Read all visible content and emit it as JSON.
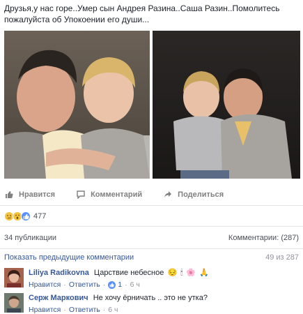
{
  "post": {
    "text": "Друзья,у нас горе..Умер сын Андрея Разина..Саша Разин..Помолитесь пожалуйста об Упокоении его души..."
  },
  "actions": {
    "like": "Нравится",
    "comment": "Комментарий",
    "share": "Поделиться"
  },
  "reactions": {
    "icons": [
      "sad-reaction-icon",
      "wow-reaction-icon",
      "like-reaction-icon"
    ],
    "count": "477"
  },
  "stats": {
    "shares": "34 публикации",
    "comments": "Комментарии: (287)"
  },
  "comments_header": {
    "prev_link": "Показать предыдущие комментарии",
    "counter": "49 из 287"
  },
  "comments": [
    {
      "author": "Liliya Radikovna",
      "text": "Царствие небесное",
      "emojis": [
        "😔",
        "🕯",
        "🌸",
        "🙏"
      ],
      "like_label": "Нравится",
      "reply_label": "Ответить",
      "likes": "1",
      "time": "6 ч"
    },
    {
      "author": "Серж Маркович",
      "text": "Не хочу ёрничать .. это не утка?",
      "like_label": "Нравится",
      "reply_label": "Ответить",
      "time": "6 ч"
    }
  ],
  "colors": {
    "link": "#365899",
    "muted": "#90949c",
    "like_blue": "#5890ff"
  }
}
